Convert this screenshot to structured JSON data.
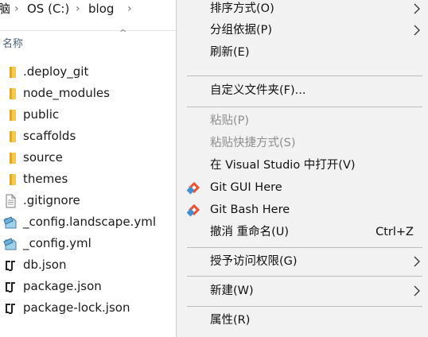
{
  "breadcrumb": {
    "partial": "脑",
    "drive": "OS (C:)",
    "folder": "blog"
  },
  "explorer": {
    "column_name": "名称",
    "files": [
      {
        "name": ".deploy_git",
        "icon": "folder-icon"
      },
      {
        "name": "node_modules",
        "icon": "folder-icon"
      },
      {
        "name": "public",
        "icon": "folder-icon"
      },
      {
        "name": "scaffolds",
        "icon": "folder-icon"
      },
      {
        "name": "source",
        "icon": "folder-icon"
      },
      {
        "name": "themes",
        "icon": "folder-icon"
      },
      {
        "name": ".gitignore",
        "icon": "text-file-icon"
      },
      {
        "name": "_config.landscape.yml",
        "icon": "yaml-file-icon"
      },
      {
        "name": "_config.yml",
        "icon": "yaml-file-icon"
      },
      {
        "name": "db.json",
        "icon": "json-file-icon"
      },
      {
        "name": "package.json",
        "icon": "json-file-icon"
      },
      {
        "name": "package-lock.json",
        "icon": "json-file-icon"
      }
    ]
  },
  "context_menu": {
    "sort_by": "排序方式(O)",
    "group_by": "分组依据(P)",
    "refresh": "刷新(E)",
    "customize_folder": "自定义文件夹(F)...",
    "paste": "粘贴(P)",
    "paste_shortcut": "粘贴快捷方式(S)",
    "open_in_vs": "在 Visual Studio 中打开(V)",
    "git_gui": "Git GUI Here",
    "git_bash": "Git Bash Here",
    "undo_rename": "撤消 重命名(U)",
    "undo_shortcut": "Ctrl+Z",
    "give_access": "授予访问权限(G)",
    "new": "新建(W)",
    "properties": "属性(R)"
  },
  "colors": {
    "menu_bg": "#f2f2f2",
    "folder": "#f7c94b",
    "git_orange": "#f05133",
    "git_blue": "#3f8fd2",
    "disabled_text": "#8e8e8e"
  }
}
